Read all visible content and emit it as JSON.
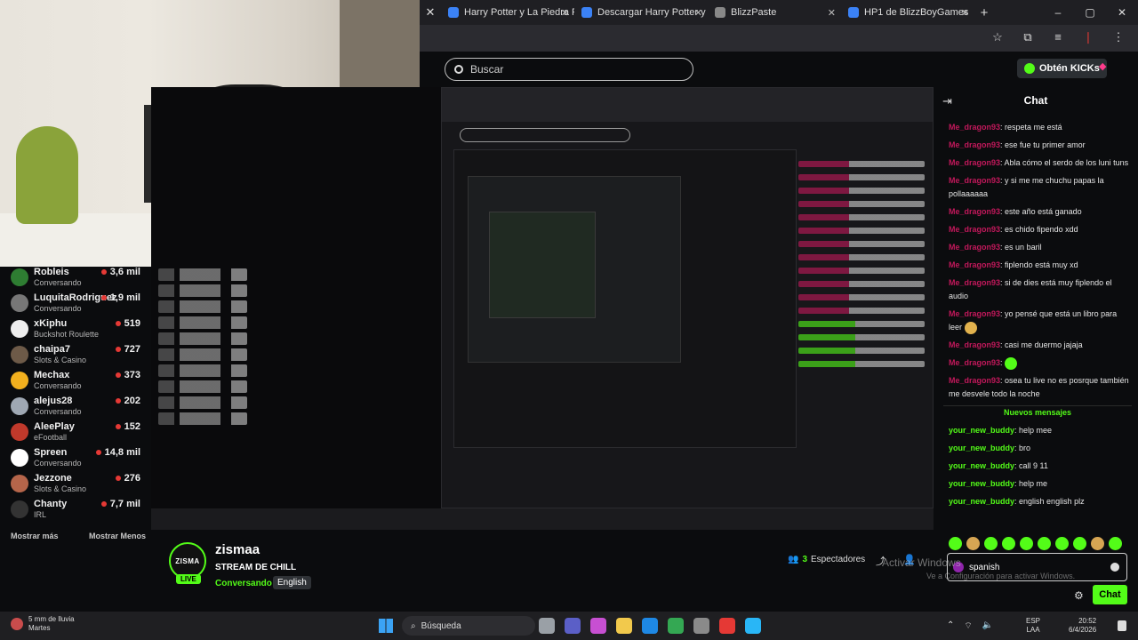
{
  "browser": {
    "tabs": [
      {
        "label": "Harry Potter y La Piedra Filosof..."
      },
      {
        "label": "Descargar Harry Potter y la Pied..."
      },
      {
        "label": "BlizzPaste"
      },
      {
        "label": "HP1 de BlizzBoyGames"
      }
    ],
    "new_tab": "+",
    "window_controls": [
      "–",
      "▢",
      "✕"
    ]
  },
  "kick": {
    "search_placeholder": "Buscar",
    "kicks_button": "Obtén KICKs"
  },
  "sidebar": {
    "channels": [
      {
        "name": "Robleis",
        "category": "Conversando",
        "viewers": "3,6 mil"
      },
      {
        "name": "LuquitaRodriguez",
        "category": "Conversando",
        "viewers": "1,9 mil"
      },
      {
        "name": "xKiphu",
        "category": "Buckshot Roulette",
        "viewers": "519"
      },
      {
        "name": "chaipa7",
        "category": "Slots & Casino",
        "viewers": "727"
      },
      {
        "name": "Mechax",
        "category": "Conversando",
        "viewers": "373"
      },
      {
        "name": "alejus28",
        "category": "Conversando",
        "viewers": "202"
      },
      {
        "name": "AleePlay",
        "category": "eFootball",
        "viewers": "152"
      },
      {
        "name": "Spreen",
        "category": "Conversando",
        "viewers": "14,8 mil"
      },
      {
        "name": "Jezzone",
        "category": "Slots & Casino",
        "viewers": "276"
      },
      {
        "name": "Chanty",
        "category": "IRL",
        "viewers": "7,7 mil"
      }
    ],
    "show_more": "Mostrar más",
    "show_less": "Mostrar Menos"
  },
  "stream": {
    "channel": "zismaa",
    "avatar_text": "ZISMA",
    "live": "LIVE",
    "title": "STREAM DE CHILL",
    "category": "Conversando",
    "language": "English",
    "viewers_count": "3",
    "viewers_label": "Espectadores"
  },
  "chat": {
    "title": "Chat",
    "messages": [
      {
        "user": "Me_dragon93",
        "text": "respeta me está"
      },
      {
        "user": "Me_dragon93",
        "text": "ese fue tu primer amor"
      },
      {
        "user": "Me_dragon93",
        "text": "Abla cómo el serdo de los luni tuns"
      },
      {
        "user": "Me_dragon93",
        "text": "y si me me chuchu papas la pollaaaaaa"
      },
      {
        "user": "Me_dragon93",
        "text": "este año está ganado"
      },
      {
        "user": "Me_dragon93",
        "text": "es chido fipendo xdd"
      },
      {
        "user": "Me_dragon93",
        "text": "es un baril"
      },
      {
        "user": "Me_dragon93",
        "text": "fiplendo está muy xd"
      },
      {
        "user": "Me_dragon93",
        "text": "si de dies está muy fiplendo el audio"
      },
      {
        "user": "Me_dragon93",
        "text": "yo pensé que está un libro para leer"
      },
      {
        "user": "Me_dragon93",
        "text": "casi me duermo jajaja"
      },
      {
        "user": "Me_dragon93",
        "text": ""
      },
      {
        "user": "Me_dragon93",
        "text": "osea tu live no es posrque también me desvele todo la noche"
      }
    ],
    "new_messages_label": "Nuevos mensajes",
    "new_messages": [
      {
        "user": "your_new_buddy",
        "text": "help mee"
      },
      {
        "user": "your_new_buddy",
        "text": "bro"
      },
      {
        "user": "your_new_buddy",
        "text": "call 9 11"
      },
      {
        "user": "your_new_buddy",
        "text": "help me"
      },
      {
        "user": "your_new_buddy",
        "text": "english english plz"
      }
    ],
    "input_value": "spanish",
    "send_label": "Chat"
  },
  "watermark": {
    "line1": "Activar Windows",
    "line2": "Ve a Configuración para activar Windows."
  },
  "taskbar": {
    "weather_temp": "5 mm de lluvia",
    "weather_day": "Martes",
    "search_label": "Búsqueda",
    "lang_1": "ESP",
    "lang_2": "LAA",
    "time": "20:52",
    "date": "6/4/2026"
  },
  "colors": {
    "accent": "#53fc18",
    "username_red": "#c2185b",
    "background": "#0b0c0e"
  }
}
